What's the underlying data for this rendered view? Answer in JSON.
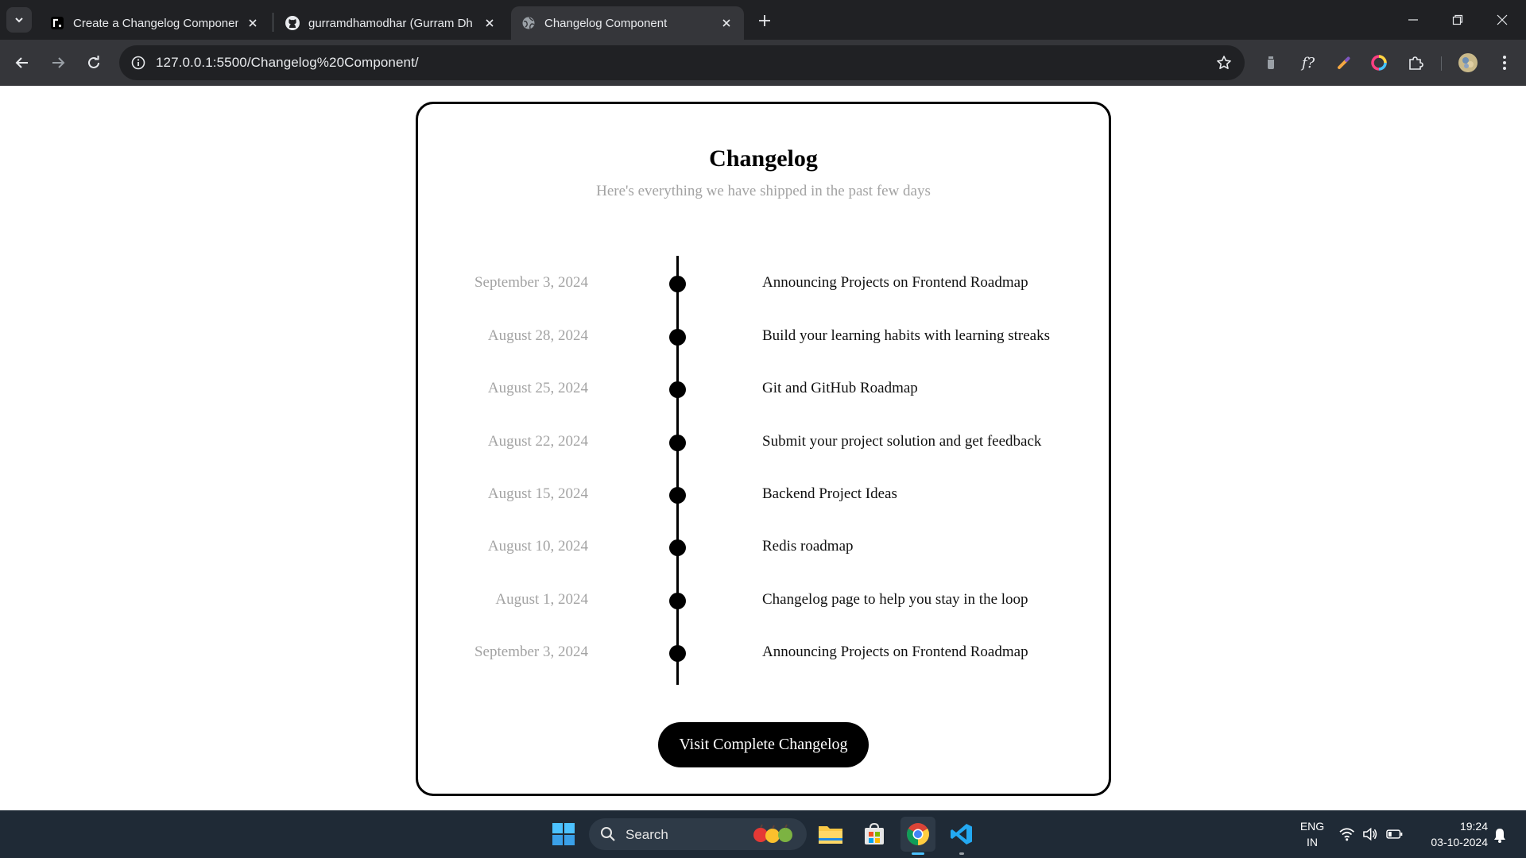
{
  "browser": {
    "tabs": [
      {
        "title": "Create a Changelog Componen",
        "favicon": "roadmap-icon",
        "active": false
      },
      {
        "title": "gurramdhamodhar (Gurram Dh",
        "favicon": "github-icon",
        "active": false
      },
      {
        "title": "Changelog Component",
        "favicon": "globe-icon",
        "active": true
      }
    ],
    "url": "127.0.0.1:5500/Changelog%20Component/",
    "extensions": [
      "extension-flask-icon",
      "function-icon",
      "pen-icon",
      "color-ring-icon",
      "puzzle-icon",
      "profile-avatar"
    ]
  },
  "page": {
    "heading": "Changelog",
    "subheading": "Here's everything we have shipped in the past few days",
    "entries": [
      {
        "date": "September 3, 2024",
        "title": "Announcing Projects on Frontend Roadmap"
      },
      {
        "date": "August 28, 2024",
        "title": "Build your learning habits with learning streaks"
      },
      {
        "date": "August 25, 2024",
        "title": "Git and GitHub Roadmap"
      },
      {
        "date": "August 22, 2024",
        "title": "Submit your project solution and get feedback"
      },
      {
        "date": "August 15, 2024",
        "title": "Backend Project Ideas"
      },
      {
        "date": "August 10, 2024",
        "title": "Redis roadmap"
      },
      {
        "date": "August 1, 2024",
        "title": "Changelog page to help you stay in the loop"
      },
      {
        "date": "September 3, 2024",
        "title": "Announcing Projects on Frontend Roadmap"
      }
    ],
    "cta_label": "Visit Complete Changelog"
  },
  "taskbar": {
    "search_label": "Search",
    "language_line1": "ENG",
    "language_line2": "IN",
    "time": "19:24",
    "date": "03-10-2024"
  },
  "colors": {
    "chrome_dark": "#202124",
    "chrome_toolbar": "#35363a",
    "muted_text": "#a3a3a3",
    "accent": "#000000",
    "taskbar": "#1f2a36"
  }
}
